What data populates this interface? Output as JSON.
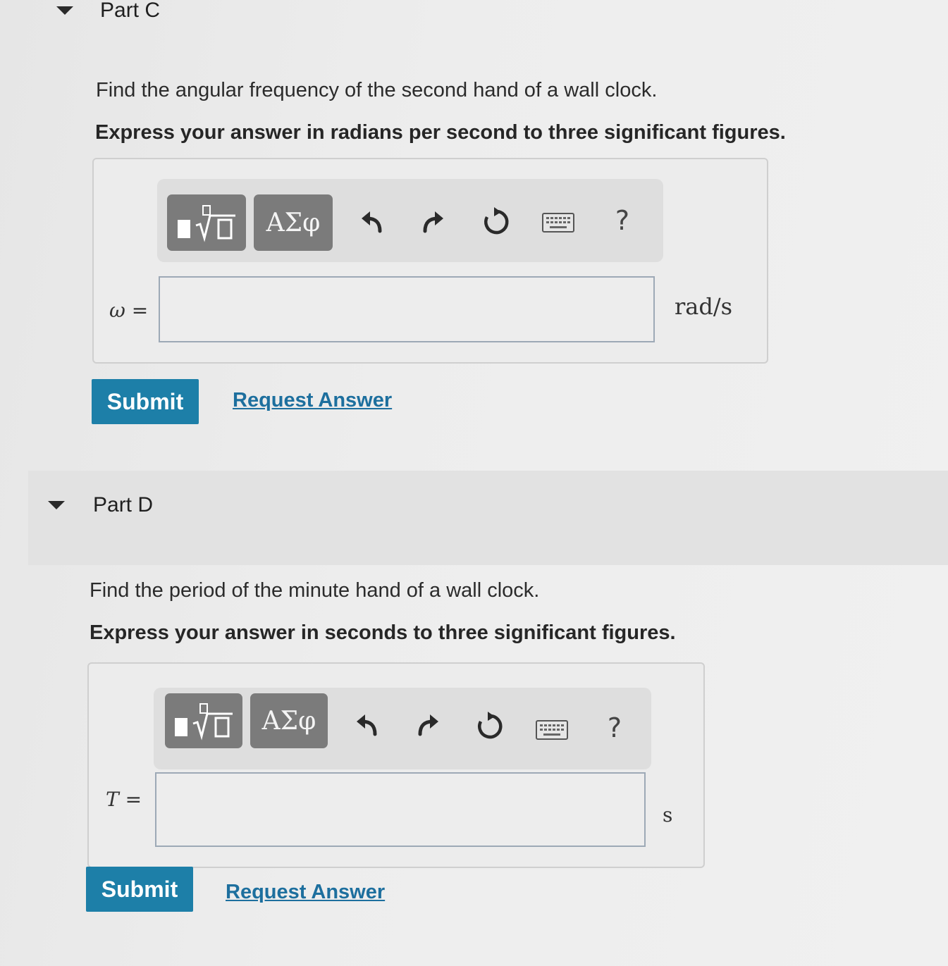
{
  "partC": {
    "title": "Part C",
    "question": "Find the angular frequency of the second hand of a wall clock.",
    "instruction": "Express your answer in radians per second to three significant figures.",
    "toolbar": {
      "greek_label": "ΑΣφ",
      "help_label": "?"
    },
    "variable_label": "ω =",
    "input_value": "",
    "unit": "rad/s",
    "submit_label": "Submit",
    "request_label": "Request Answer"
  },
  "partD": {
    "title": "Part D",
    "question": "Find the period of the minute hand of a wall clock.",
    "instruction": "Express your answer in seconds to three significant figures.",
    "toolbar": {
      "greek_label": "ΑΣφ",
      "help_label": "?"
    },
    "variable_label": "T =",
    "input_value": "",
    "unit": "s",
    "submit_label": "Submit",
    "request_label": "Request Answer"
  },
  "icons": {
    "template": "fraction-root-template-icon",
    "undo": "undo-icon",
    "redo": "redo-icon",
    "reset": "reset-icon",
    "keyboard": "keyboard-icon"
  },
  "colors": {
    "submit": "#1d7fa8",
    "link": "#1d6f9e",
    "toolbar_button": "#7b7b7b"
  }
}
